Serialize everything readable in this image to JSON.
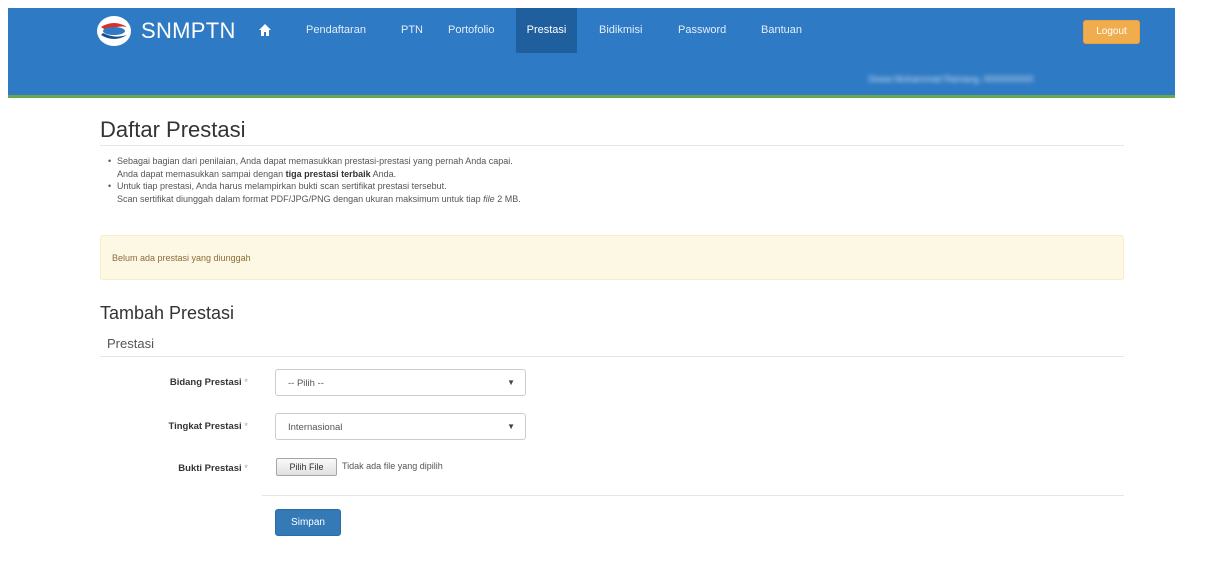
{
  "nav": {
    "brand": "SNMPTN",
    "items": [
      {
        "label": "Pendaftaran",
        "active": false
      },
      {
        "label": "PTN",
        "active": false
      },
      {
        "label": "Portofolio",
        "active": false
      },
      {
        "label": "Prestasi",
        "active": true
      },
      {
        "label": "Bidikmisi",
        "active": false
      },
      {
        "label": "Password",
        "active": false
      },
      {
        "label": "Bantuan",
        "active": false
      }
    ],
    "logout": "Logout",
    "user": "Siswa Muhammad Ramang, 0000000000"
  },
  "page": {
    "title": "Daftar Prestasi",
    "info": [
      {
        "line1": "Sebagai bagian dari penilaian, Anda dapat memasukkan prestasi-prestasi yang pernah Anda capai.",
        "line2_before": "Anda dapat memasukkan sampai dengan ",
        "line2_bold": "tiga prestasi terbaik",
        "line2_after": " Anda."
      },
      {
        "line1": "Untuk tiap prestasi, Anda harus melampirkan bukti scan sertifikat prestasi tersebut.",
        "line2_before": "Scan sertifikat diunggah dalam format PDF/JPG/PNG dengan ukuran maksimum untuk tiap ",
        "line2_italic": "file",
        "line2_after": " 2 MB."
      }
    ],
    "alert": "Belum ada prestasi yang diunggah"
  },
  "form": {
    "title": "Tambah Prestasi",
    "legend": "Prestasi",
    "bidang_label": "Bidang Prestasi",
    "bidang_value": "-- Pilih --",
    "tingkat_label": "Tingkat Prestasi",
    "tingkat_value": "Internasional",
    "bukti_label": "Bukti Prestasi",
    "file_button": "Pilih File",
    "file_note": "Tidak ada file yang dipilih",
    "required_mark": "*",
    "submit": "Simpan"
  },
  "colors": {
    "navbar": "#2e7ac4",
    "active_tab": "#1f5f9e",
    "logout": "#f0ad4e",
    "alert_bg": "#fcf8e3",
    "primary": "#337ab7"
  },
  "icons": [
    "home-icon",
    "dropdown-caret-icon",
    "snmptn-logo"
  ]
}
